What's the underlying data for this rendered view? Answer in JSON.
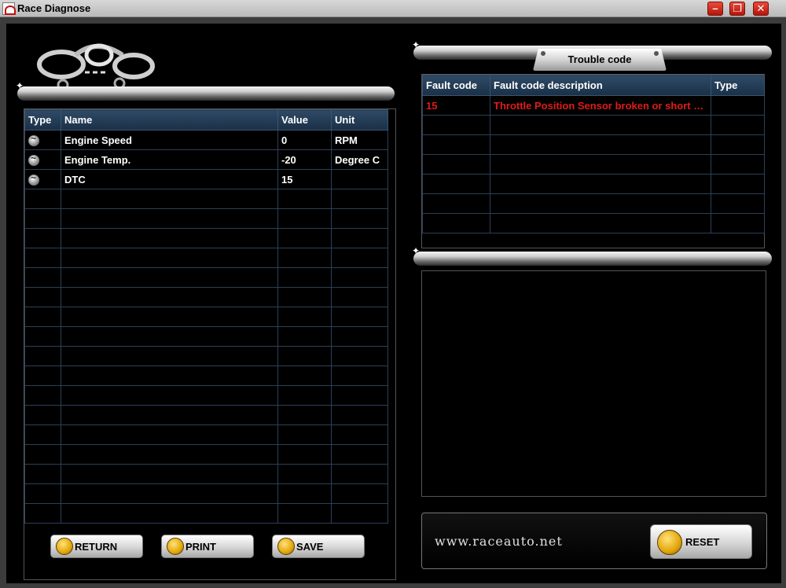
{
  "window": {
    "title": "Race Diagnose",
    "icon": "race-app-icon",
    "controls": {
      "minimize": "–",
      "restore": "❐",
      "close": "✕"
    }
  },
  "sensor_table": {
    "headers": {
      "type": "Type",
      "name": "Name",
      "value": "Value",
      "unit": "Unit"
    },
    "rows": [
      {
        "icon": "sensor-gauge-icon",
        "name": "Engine Speed",
        "value": "0",
        "unit": "RPM"
      },
      {
        "icon": "sensor-gauge-icon",
        "name": "Engine Temp.",
        "value": "-20",
        "unit": "Degree C"
      },
      {
        "icon": "sensor-gauge-icon",
        "name": "DTC",
        "value": "15",
        "unit": ""
      }
    ]
  },
  "buttons": {
    "return": "RETURN",
    "print": "PRINT",
    "save": "SAVE",
    "reset": "RESET"
  },
  "trouble_code": {
    "tab": "Trouble code",
    "headers": {
      "code": "Fault code",
      "description": "Fault code description",
      "type": "Type"
    },
    "rows": [
      {
        "code": "15",
        "description": "Throttle Position Sensor broken or short c...",
        "type": ""
      }
    ]
  },
  "footer": {
    "url": "www.raceauto.net"
  },
  "colors": {
    "fault_text": "#e01b1b",
    "header_bg": "#1a3047",
    "window_button": "#c8251a"
  }
}
